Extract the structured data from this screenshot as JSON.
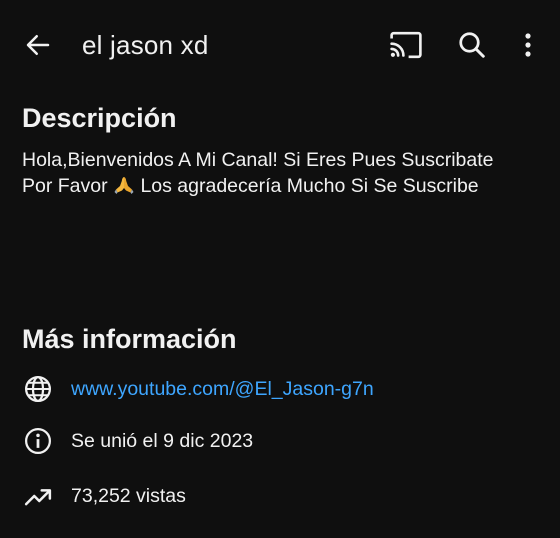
{
  "header": {
    "channel_name": "el jason xd",
    "icons": {
      "back": "arrow-back-icon",
      "cast": "cast-icon",
      "search": "search-icon",
      "more": "more-vert-icon"
    }
  },
  "description_section": {
    "title": "Descripción",
    "text_line1": "Hola,Bienvenidos A Mi Canal! Si Eres Pues Suscribate",
    "text_line2_before": "Por Favor ",
    "emoji": "folded-hands-emoji",
    "text_line2_after": " Los agradecería Mucho Si Se Suscribe"
  },
  "more_info_section": {
    "title": "Más información",
    "channel_link": "www.youtube.com/@El_Jason-g7n",
    "joined": "Se unió el 9 dic 2023",
    "views": "73,252 vistas",
    "icons": {
      "link": "globe-icon",
      "joined": "info-icon",
      "views": "trending-up-icon"
    }
  },
  "colors": {
    "background": "#0f0f0f",
    "text": "#f1f1f1",
    "link": "#3ea6ff"
  }
}
